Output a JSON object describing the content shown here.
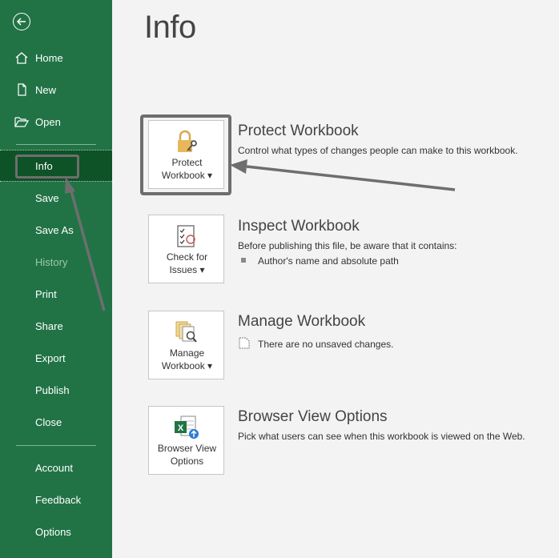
{
  "sidebar": {
    "items": [
      {
        "label": "Home"
      },
      {
        "label": "New"
      },
      {
        "label": "Open"
      },
      {
        "label": "Info"
      },
      {
        "label": "Save"
      },
      {
        "label": "Save As"
      },
      {
        "label": "History"
      },
      {
        "label": "Print"
      },
      {
        "label": "Share"
      },
      {
        "label": "Export"
      },
      {
        "label": "Publish"
      },
      {
        "label": "Close"
      },
      {
        "label": "Account"
      },
      {
        "label": "Feedback"
      },
      {
        "label": "Options"
      }
    ],
    "selected": "Info"
  },
  "main": {
    "title": "Info",
    "sections": [
      {
        "tile_label": "Protect\nWorkbook ▾",
        "title": "Protect Workbook",
        "description": "Control what types of changes people can make to this workbook."
      },
      {
        "tile_label": "Check for\nIssues ▾",
        "title": "Inspect Workbook",
        "description": "Before publishing this file, be aware that it contains:",
        "bullets": [
          "Author's name and absolute path"
        ]
      },
      {
        "tile_label": "Manage\nWorkbook ▾",
        "title": "Manage Workbook",
        "description": "There are no unsaved changes."
      },
      {
        "tile_label": "Browser View\nOptions",
        "title": "Browser View Options",
        "description": "Pick what users can see when this workbook is viewed on the Web."
      }
    ]
  },
  "colors": {
    "sidebar_bg": "#217346",
    "sidebar_selected": "#0e5228",
    "annotation": "#6e6e6e"
  }
}
